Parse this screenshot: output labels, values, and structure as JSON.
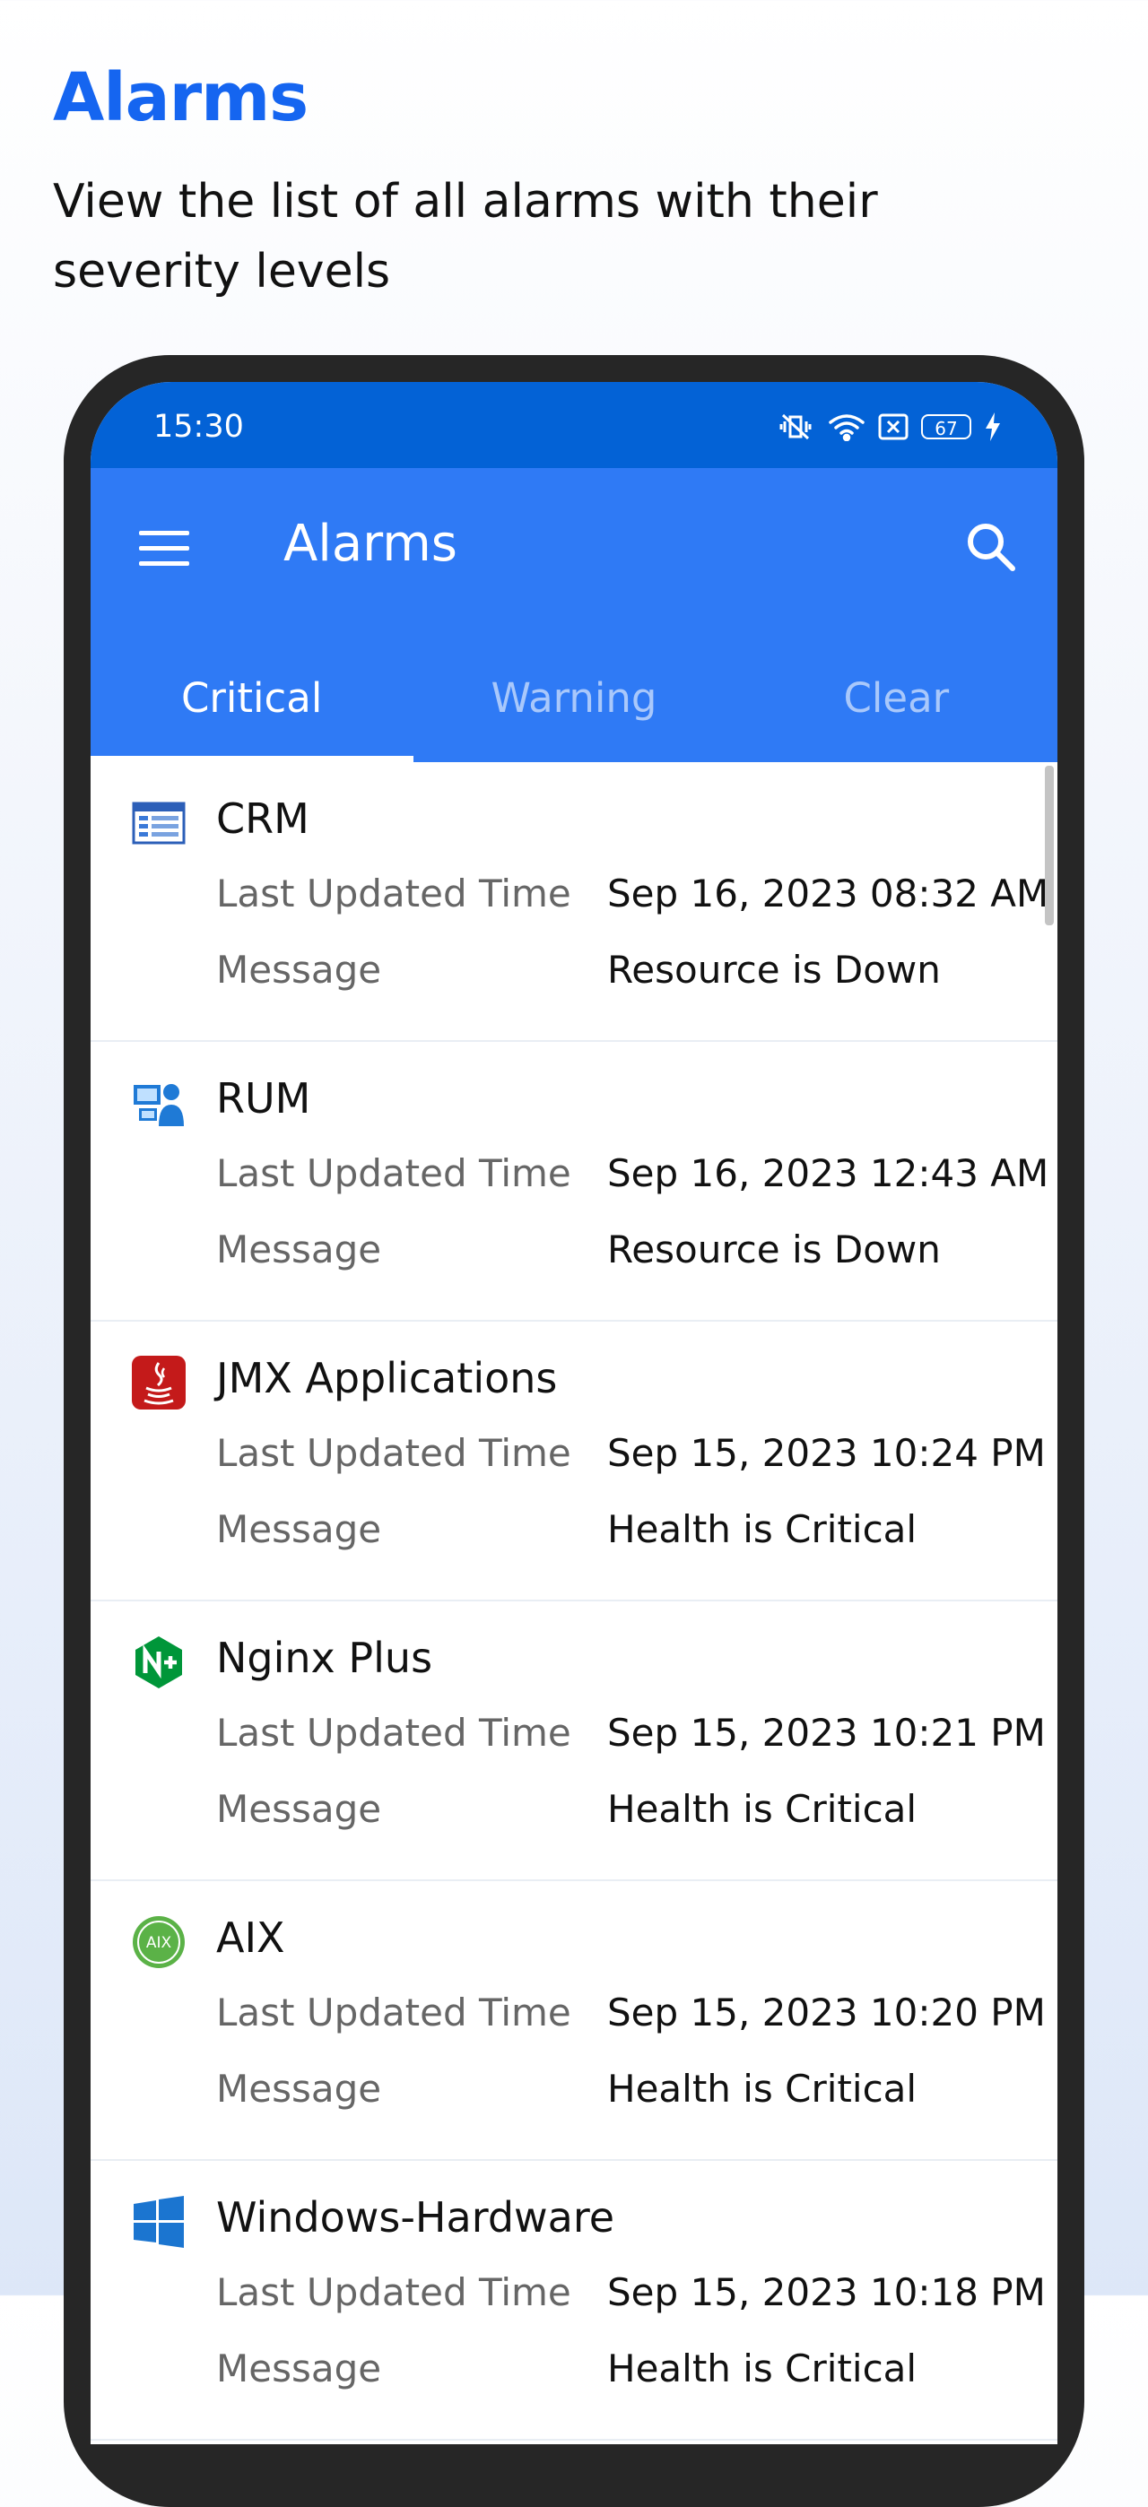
{
  "promo": {
    "title": "Alarms",
    "subtitle": "View the list of all alarms with their severity levels"
  },
  "statusbar": {
    "time": "15:30",
    "battery": "67",
    "icons": [
      "vibrate-off-icon",
      "wifi-icon",
      "sim-off-icon",
      "battery-icon",
      "charging-icon"
    ]
  },
  "appbar": {
    "title": "Alarms",
    "menu_icon": "hamburger-menu-icon",
    "search_icon": "search-icon"
  },
  "tabs": [
    {
      "label": "Critical",
      "active": true
    },
    {
      "label": "Warning",
      "active": false
    },
    {
      "label": "Clear",
      "active": false
    }
  ],
  "labels": {
    "last_updated": "Last Updated Time",
    "message": "Message"
  },
  "colors": {
    "status_bar": "#0362d6",
    "app_bar": "#2f7af5",
    "promo_title": "#1565f0"
  },
  "alarms": [
    {
      "name": "CRM",
      "icon": "crm-table-icon",
      "time": "Sep 16, 2023 08:32 AM",
      "message": "Resource is Down"
    },
    {
      "name": "RUM",
      "icon": "rum-user-icon",
      "time": "Sep 16, 2023 12:43 AM",
      "message": "Resource is Down"
    },
    {
      "name": "JMX Applications",
      "icon": "java-icon",
      "time": "Sep 15, 2023 10:24 PM",
      "message": "Health is Critical"
    },
    {
      "name": "Nginx Plus",
      "icon": "nginx-plus-icon",
      "time": "Sep 15, 2023 10:21 PM",
      "message": "Health is Critical"
    },
    {
      "name": "AIX",
      "icon": "aix-icon",
      "time": "Sep 15, 2023 10:20 PM",
      "message": "Health is Critical"
    },
    {
      "name": "Windows-Hardware",
      "icon": "windows-icon",
      "time": "Sep 15, 2023 10:18 PM",
      "message": "Health is Critical"
    }
  ]
}
